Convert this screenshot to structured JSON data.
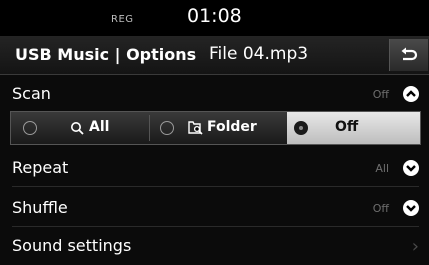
{
  "status": {
    "reg": "REG",
    "time": "01:08"
  },
  "header": {
    "title": "USB Music | Options",
    "file": "File 04.mp3",
    "back_icon": "return-arrow-icon"
  },
  "scan": {
    "label": "Scan",
    "value": "Off",
    "options": [
      {
        "label": "All",
        "icon": "search-icon",
        "selected": false
      },
      {
        "label": "Folder",
        "icon": "folder-search-icon",
        "selected": false
      },
      {
        "label": "Off",
        "selected": true
      }
    ]
  },
  "repeat": {
    "label": "Repeat",
    "value": "All"
  },
  "shuffle": {
    "label": "Shuffle",
    "value": "Off"
  },
  "sound": {
    "label": "Sound settings"
  }
}
